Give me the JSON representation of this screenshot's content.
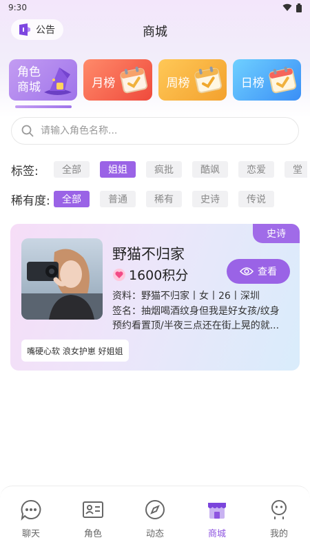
{
  "status": {
    "time": "9:30"
  },
  "header": {
    "announce_label": "公告",
    "title": "商城"
  },
  "rank_tabs": [
    {
      "label": "角色商城",
      "icon": "wizard-hat-icon",
      "color": "#a97ded"
    },
    {
      "label": "月榜",
      "icon": "calendar-icon",
      "color": "#f25a44"
    },
    {
      "label": "周榜",
      "icon": "calendar-icon",
      "color": "#f7b040"
    },
    {
      "label": "日榜",
      "icon": "calendar-icon",
      "color": "#4aa6f8"
    }
  ],
  "search": {
    "placeholder": "请输入角色名称..."
  },
  "filters": {
    "tags_label": "标签:",
    "tags": [
      "全部",
      "姐姐",
      "疯批",
      "酷飒",
      "恋爱",
      "堂"
    ],
    "tags_active": 1,
    "rarity_label": "稀有度:",
    "rarity": [
      "全部",
      "普通",
      "稀有",
      "史诗",
      "传说"
    ],
    "rarity_active": 0
  },
  "card": {
    "rarity": "史诗",
    "name": "野猫不归家",
    "points": "1600积分",
    "view_label": "查看",
    "profile": "资料：野猫不归家丨女丨26丨深圳",
    "bio_line1": "签名：抽烟喝酒纹身但我是好女孩/纹身",
    "bio_line2": "预约看置顶/半夜三点还在街上晃的就...",
    "tags": "嘴硬心软 浪女护崽 好姐姐"
  },
  "nav": [
    {
      "label": "聊天",
      "icon": "chat-icon"
    },
    {
      "label": "角色",
      "icon": "id-card-icon"
    },
    {
      "label": "动态",
      "icon": "compass-icon"
    },
    {
      "label": "商城",
      "icon": "shop-icon",
      "active": true
    },
    {
      "label": "我的",
      "icon": "profile-icon"
    }
  ],
  "colors": {
    "accent": "#9a63e6"
  }
}
